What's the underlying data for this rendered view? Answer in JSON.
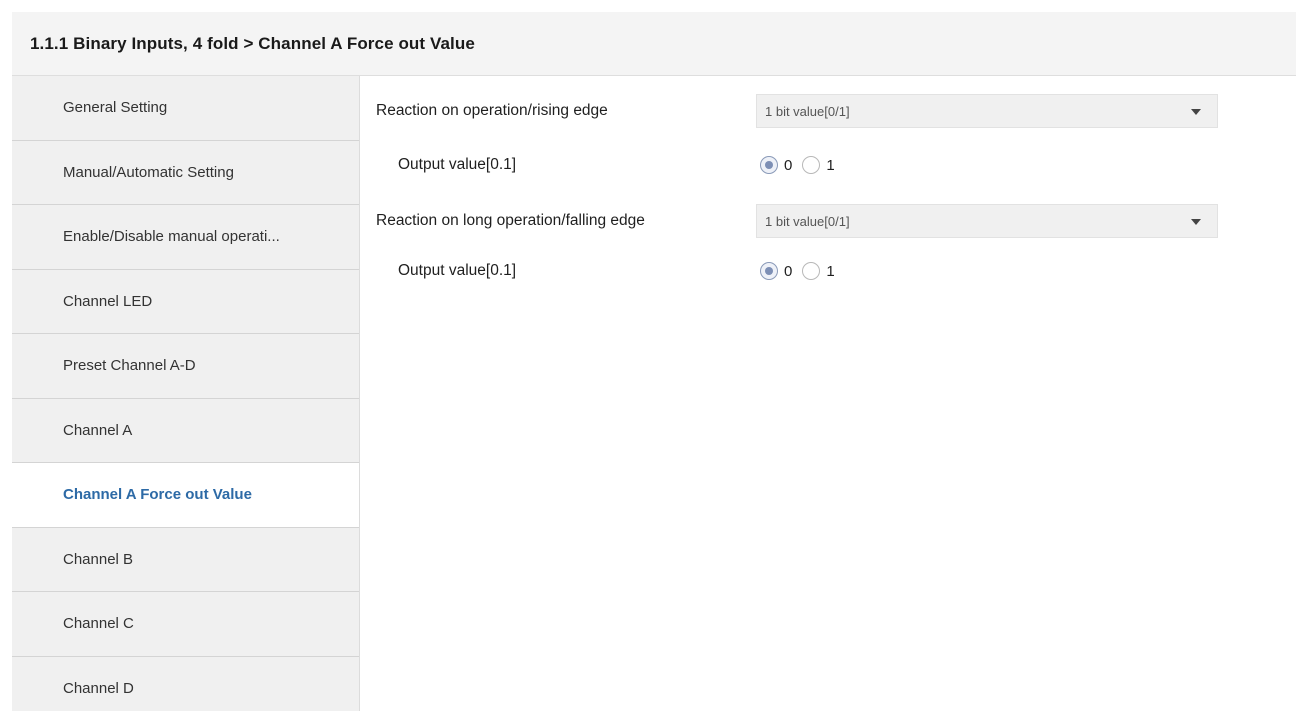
{
  "header": {
    "title": "1.1.1 Binary Inputs, 4 fold > Channel A Force out Value"
  },
  "sidebar": {
    "items": [
      {
        "label": "General Setting",
        "active": false
      },
      {
        "label": "Manual/Automatic Setting",
        "active": false
      },
      {
        "label": "Enable/Disable manual operati...",
        "active": false
      },
      {
        "label": "Channel LED",
        "active": false
      },
      {
        "label": "Preset Channel A-D",
        "active": false
      },
      {
        "label": "Channel A",
        "active": false
      },
      {
        "label": "Channel A Force out Value",
        "active": true
      },
      {
        "label": "Channel B",
        "active": false
      },
      {
        "label": "Channel C",
        "active": false
      },
      {
        "label": "Channel D",
        "active": false
      }
    ]
  },
  "params": {
    "rising": {
      "label": "Reaction on operation/rising edge",
      "value": "1 bit value[0/1]"
    },
    "rising_output": {
      "label": "Output value[0.1]",
      "options": [
        "0",
        "1"
      ],
      "selected": "0"
    },
    "falling": {
      "label": "Reaction on long operation/falling edge",
      "value": "1 bit value[0/1]"
    },
    "falling_output": {
      "label": "Output value[0.1]",
      "options": [
        "0",
        "1"
      ],
      "selected": "0"
    }
  },
  "colors": {
    "active_item": "#2d6aa6",
    "sidebar_bg": "#f0f0f0",
    "header_bg": "#f4f4f4"
  }
}
